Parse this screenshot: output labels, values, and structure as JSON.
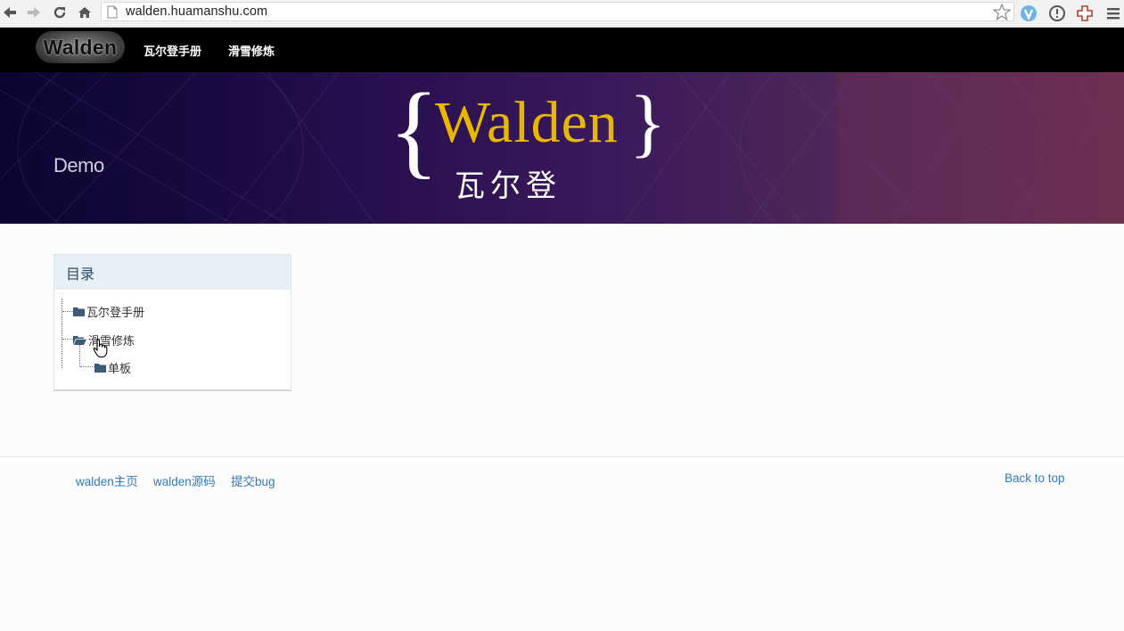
{
  "browser": {
    "url": "walden.huamanshu.com"
  },
  "navbar": {
    "brand": "Walden",
    "links": [
      {
        "label": "瓦尔登手册"
      },
      {
        "label": "滑雪修炼"
      }
    ]
  },
  "banner": {
    "left_text": "Demo",
    "logo_word": "Walden",
    "logo_subtitle": "瓦尔登"
  },
  "toc": {
    "title": "目录",
    "items": [
      {
        "label": "瓦尔登手册",
        "icon": "folder-closed"
      },
      {
        "label": "滑雪修炼",
        "icon": "folder-open",
        "children": [
          {
            "label": "单板",
            "icon": "folder-closed"
          }
        ]
      }
    ]
  },
  "footer": {
    "links": [
      {
        "label": "walden主页"
      },
      {
        "label": "walden源码"
      },
      {
        "label": "提交bug"
      }
    ],
    "back_to_top": "Back to top"
  },
  "colors": {
    "navbar_bg": "#000000",
    "toc_head_bg": "#e6f0f6",
    "link": "#337ab7",
    "logo_gold": "#e8b800"
  }
}
